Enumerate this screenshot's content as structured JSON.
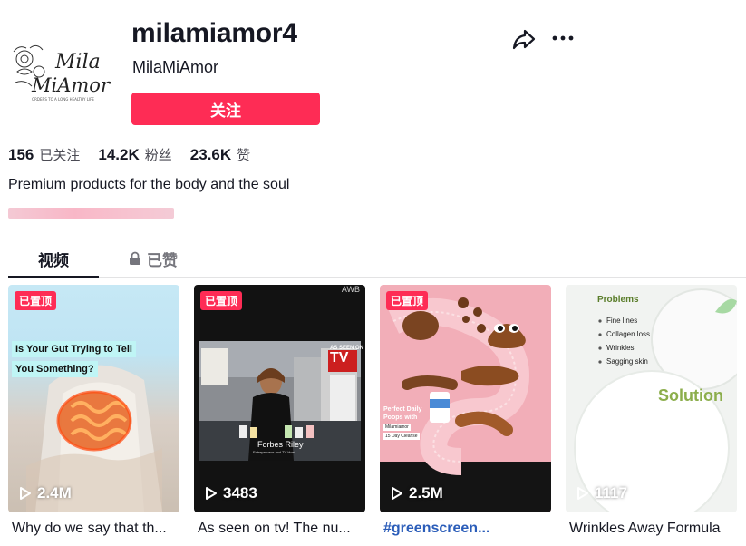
{
  "profile": {
    "username": "milamiamor4",
    "nickname": "MilaMiAmor",
    "follow_label": "关注",
    "avatar_text_line1": "Mila",
    "avatar_text_line2": "MiAmor",
    "avatar_tagline": "ORDERS TO A LONG HEALTHY LIFE",
    "bio": "Premium products for the body and the soul"
  },
  "icons": {
    "share": "share-arrow-icon",
    "more": "more-dots-icon",
    "lock": "lock-icon",
    "play": "play-icon"
  },
  "stats": [
    {
      "num": "156",
      "label": "已关注"
    },
    {
      "num": "14.2K",
      "label": "粉丝"
    },
    {
      "num": "23.6K",
      "label": "赞"
    }
  ],
  "tabs": {
    "videos": "视频",
    "liked": "已赞"
  },
  "colors": {
    "accent": "#fe2c55",
    "hashtag": "#2b5db9"
  },
  "videos": [
    {
      "pinned_label": "已置顶",
      "views": "2.4M",
      "caption": "Why do we say that th...",
      "overlay_line1": "Is Your Gut Trying to Tell",
      "overlay_line2": "You Something?"
    },
    {
      "pinned_label": "已置顶",
      "views": "3483",
      "caption": "As seen on tv! The nu...",
      "overlay_corner": "AWB",
      "overlay_tv1": "AS SEEN ON",
      "overlay_tv2": "TV",
      "overlay_name": "Forbes Riley",
      "overlay_role": "Entrepreneur and TV Host"
    },
    {
      "pinned_label": "已置顶",
      "views": "2.5M",
      "caption": "#greenscreen...",
      "overlay_line1": "Perfect Daily",
      "overlay_line2": "Poops with",
      "overlay_product": "Milamiamor",
      "overlay_product2": "15 Day Cleanse"
    },
    {
      "views": "1117",
      "caption": "Wrinkles Away Formula",
      "overlay_title": "Problems",
      "overlay_items": [
        "Fine lines",
        "Collagen loss",
        "Wrinkles",
        "Sagging skin"
      ],
      "overlay_solution": "Solution"
    }
  ]
}
